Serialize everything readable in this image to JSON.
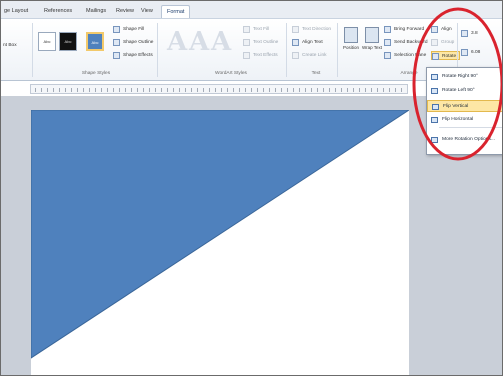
{
  "tabs": [
    "ge Layout",
    "References",
    "Mailings",
    "Review",
    "View",
    "Format"
  ],
  "ribbon": {
    "insert_shapes": {
      "items": [
        "",
        "nt Box"
      ]
    },
    "shape_styles": {
      "label": "Shape Styles",
      "swatches": [
        "Abc",
        "Abc",
        "Abc"
      ],
      "fill": "Shape Fill",
      "outline": "Shape Outline",
      "effects": "Shape Effects"
    },
    "wordart_styles": {
      "label": "WordArt Styles",
      "letters": [
        "A",
        "A",
        "A"
      ],
      "text_fill": "Text Fill",
      "text_outline": "Text Outline",
      "text_effects": "Text Effects"
    },
    "text": {
      "label": "Text",
      "direction": "Text Direction",
      "align": "Align Text",
      "link": "Create Link"
    },
    "arrange": {
      "label": "Arrange",
      "position": "Position",
      "wrap": "Wrap Text",
      "bring_forward": "Bring Forward",
      "send_backward": "Send Backward",
      "selection_pane": "Selection Pane",
      "align": "Align",
      "group": "Group",
      "rotate": "Rotate"
    },
    "size": {
      "height": "3.8",
      "width": "6.08"
    }
  },
  "rotate_menu": {
    "items": [
      "Rotate Right 90°",
      "Rotate Left 90°",
      "Flip Vertical",
      "Flip Horizontal",
      "More Rotation Options..."
    ],
    "highlighted_index": 2
  },
  "colors": {
    "shape_fill": "#4f81bd",
    "highlight": "#fde7a5",
    "callout": "#d9232e"
  }
}
